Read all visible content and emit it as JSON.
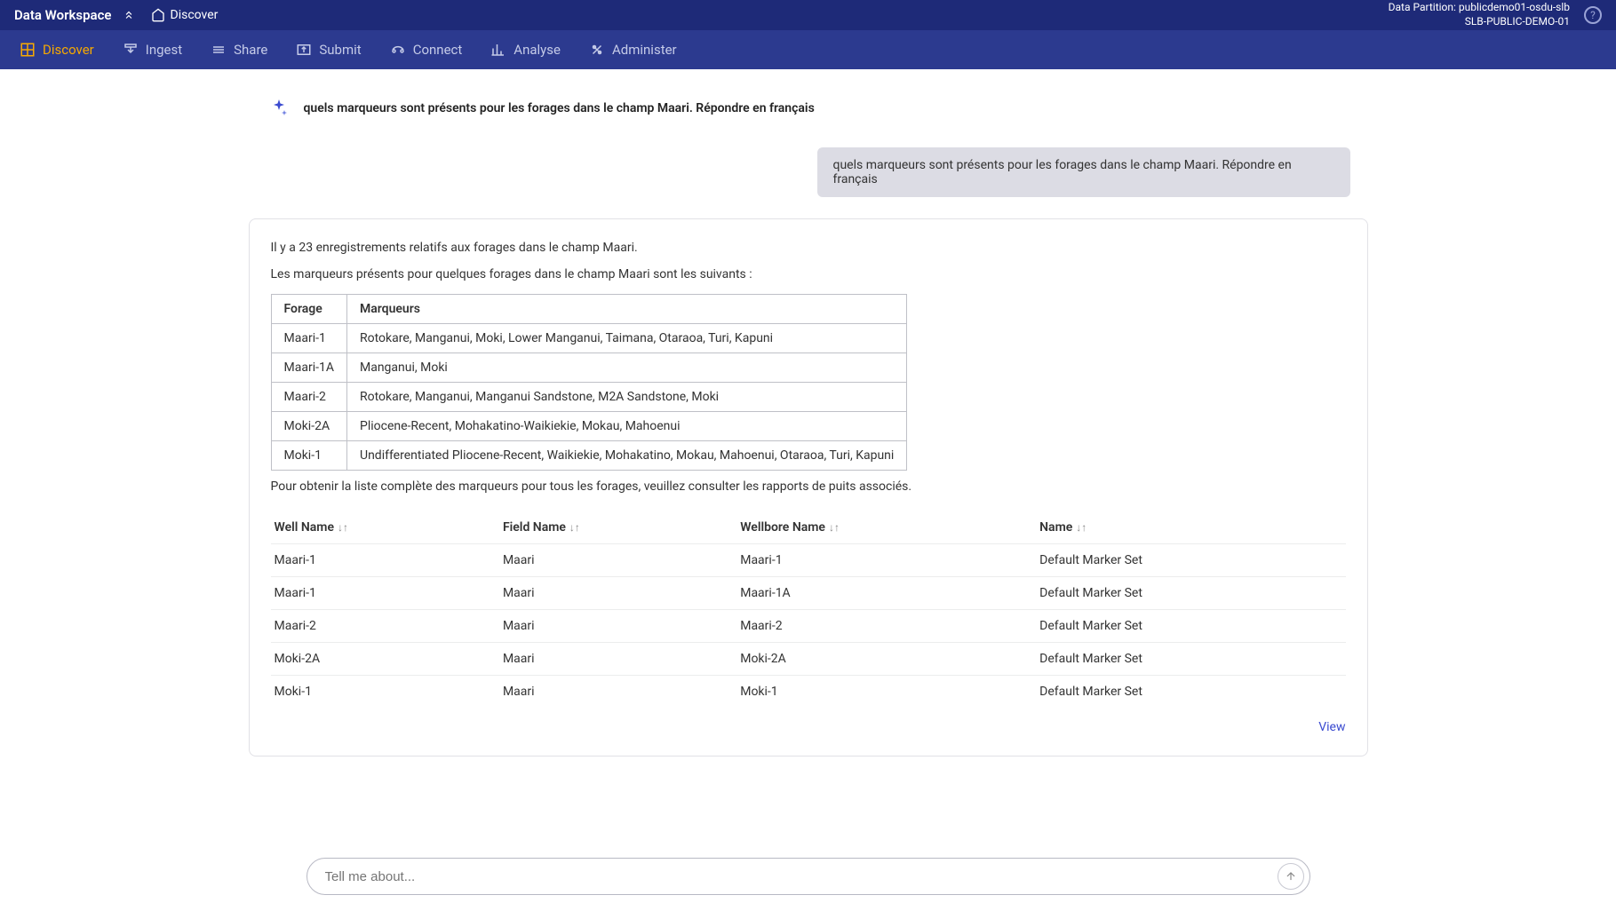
{
  "topbar": {
    "brand": "Data Workspace",
    "page": "Discover",
    "partition_label": "Data Partition: publicdemo01-osdu-slb",
    "partition_name": "SLB-PUBLIC-DEMO-01"
  },
  "nav": {
    "items": [
      {
        "label": "Discover",
        "icon": "grid-icon"
      },
      {
        "label": "Ingest",
        "icon": "ingest-icon"
      },
      {
        "label": "Share",
        "icon": "share-icon"
      },
      {
        "label": "Submit",
        "icon": "submit-icon"
      },
      {
        "label": "Connect",
        "icon": "connect-icon"
      },
      {
        "label": "Analyse",
        "icon": "analyse-icon"
      },
      {
        "label": "Administer",
        "icon": "administer-icon"
      }
    ]
  },
  "chat": {
    "prompt": "quels marqueurs sont présents pour les forages dans le champ Maari. Répondre en français",
    "user_message": "quels marqueurs sont présents pour les forages dans le champ Maari. Répondre en français",
    "response_intro": "Il y a 23 enregistrements relatifs aux forages dans le champ Maari.",
    "response_sub": "Les marqueurs présents pour quelques forages dans le champ Maari sont les suivants :",
    "response_outro": "Pour obtenir la liste complète des marqueurs pour tous les forages, veuillez consulter les rapports de puits associés.",
    "markers_table": {
      "headers": [
        "Forage",
        "Marqueurs"
      ],
      "rows": [
        {
          "forage": "Maari-1",
          "markers": "Rotokare, Manganui, Moki, Lower Manganui, Taimana, Otaraoa, Turi, Kapuni"
        },
        {
          "forage": "Maari-1A",
          "markers": "Manganui, Moki"
        },
        {
          "forage": "Maari-2",
          "markers": "Rotokare, Manganui, Manganui Sandstone, M2A Sandstone, Moki"
        },
        {
          "forage": "Moki-2A",
          "markers": "Pliocene-Recent, Mohakatino-Waikiekie, Mokau, Mahoenui"
        },
        {
          "forage": "Moki-1",
          "markers": "Undifferentiated Pliocene-Recent, Waikiekie, Mohakatino, Mokau, Mahoenui, Otaraoa, Turi, Kapuni"
        }
      ]
    },
    "results_table": {
      "headers": [
        "Well Name",
        "Field Name",
        "Wellbore Name",
        "Name"
      ],
      "rows": [
        {
          "well": "Maari-1",
          "field": "Maari",
          "wellbore": "Maari-1",
          "name": "Default Marker Set"
        },
        {
          "well": "Maari-1",
          "field": "Maari",
          "wellbore": "Maari-1A",
          "name": "Default Marker Set"
        },
        {
          "well": "Maari-2",
          "field": "Maari",
          "wellbore": "Maari-2",
          "name": "Default Marker Set"
        },
        {
          "well": "Moki-2A",
          "field": "Maari",
          "wellbore": "Moki-2A",
          "name": "Default Marker Set"
        },
        {
          "well": "Moki-1",
          "field": "Maari",
          "wellbore": "Moki-1",
          "name": "Default Marker Set"
        }
      ]
    },
    "view_link": "View"
  },
  "input": {
    "placeholder": "Tell me about..."
  }
}
